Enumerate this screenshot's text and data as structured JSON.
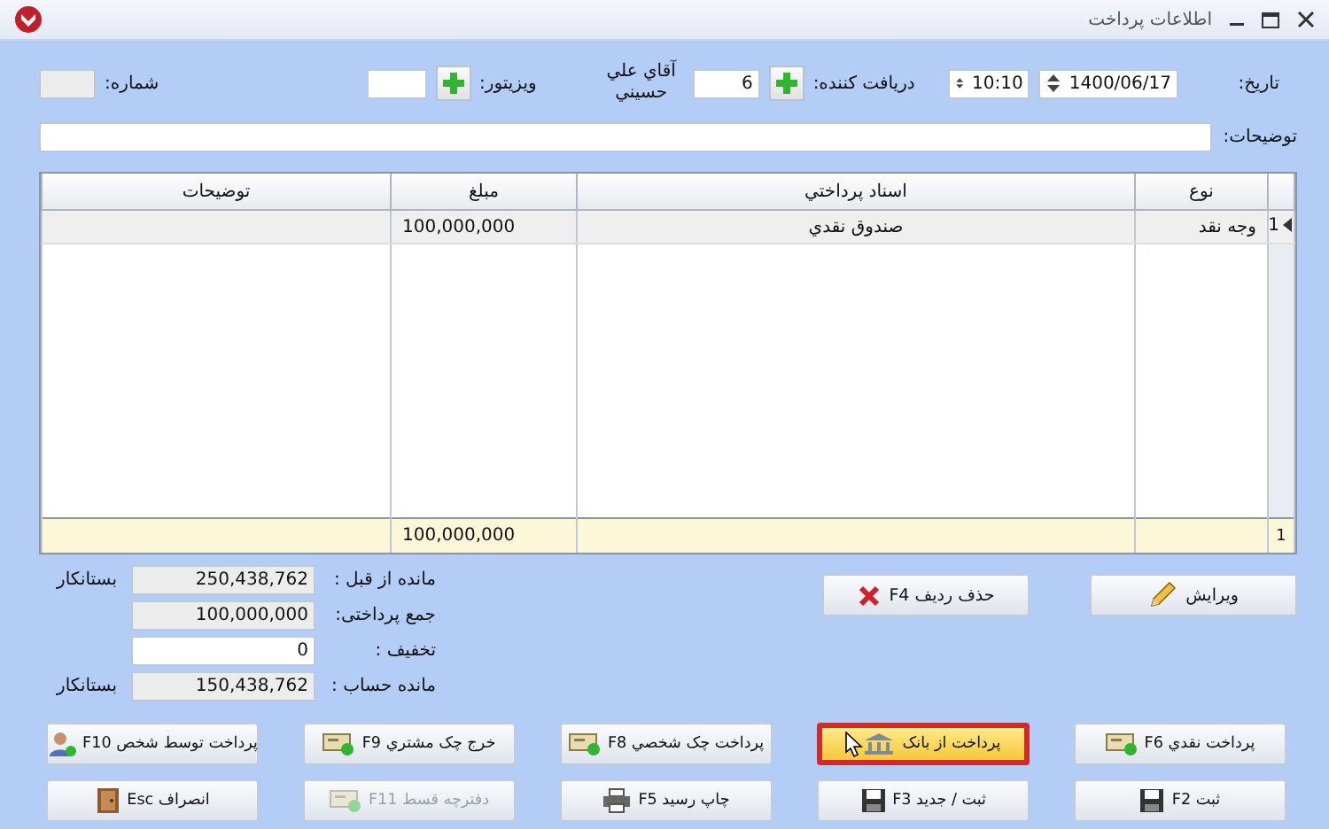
{
  "window": {
    "title": "اطلاعات پرداخت"
  },
  "header": {
    "date_label": "تاريخ:",
    "date": "1400/06/17",
    "time": "10:10",
    "recipient_label": "دریافت کننده:",
    "recipient_code": "6",
    "recipient_name": "آقاي علي حسيني",
    "visitor_label": "ویزیتور:",
    "number_label": "شماره:",
    "description_label": "توضیحات:"
  },
  "table": {
    "columns": [
      "نوع",
      "اسناد پرداختي",
      "مبلغ",
      "توضیحات"
    ],
    "rows": [
      {
        "row_number": "1",
        "selected": true,
        "cells": [
          "وجه نقد",
          "صندوق نقدي",
          "100,000,000",
          ""
        ]
      }
    ],
    "footer": {
      "count": "1",
      "cells": [
        "",
        "",
        "100,000,000",
        ""
      ]
    }
  },
  "row_buttons": [
    {
      "label": "ویرایش"
    },
    {
      "label": "حذف ردیف F4"
    }
  ],
  "summary": [
    {
      "label": "مانده از قبل :",
      "value": "250,438,762",
      "editable": false,
      "note": "بستانکار"
    },
    {
      "label": "جمع پرداختی:",
      "value": "100,000,000",
      "editable": false
    },
    {
      "label": "تخفیف :",
      "value": "0",
      "editable": true
    },
    {
      "label": "مانده حساب :",
      "value": "150,438,762",
      "editable": false,
      "note": "بستانکار"
    }
  ],
  "buttons": [
    {
      "label": "پرداخت نقدي F6",
      "highlighted": false,
      "disabled": false
    },
    {
      "label": "پرداخت از بانک",
      "highlighted": true,
      "disabled": false
    },
    {
      "label": "پرداخت چک شخصي F8",
      "highlighted": false,
      "disabled": false
    },
    {
      "label": "خرج چک مشتري F9",
      "highlighted": false,
      "disabled": false
    },
    {
      "label": "پرداخت توسط شخص F10",
      "highlighted": false,
      "disabled": false
    },
    {
      "label": "ثبت F2",
      "highlighted": false,
      "disabled": false
    },
    {
      "label": "ثبت / جدید F3",
      "highlighted": false,
      "disabled": false
    },
    {
      "label": "چاپ رسید F5",
      "highlighted": false,
      "disabled": false
    },
    {
      "label": "دفترچه قسط F11",
      "highlighted": false,
      "disabled": true
    },
    {
      "label": "انصراف Esc",
      "highlighted": false,
      "disabled": false
    }
  ]
}
